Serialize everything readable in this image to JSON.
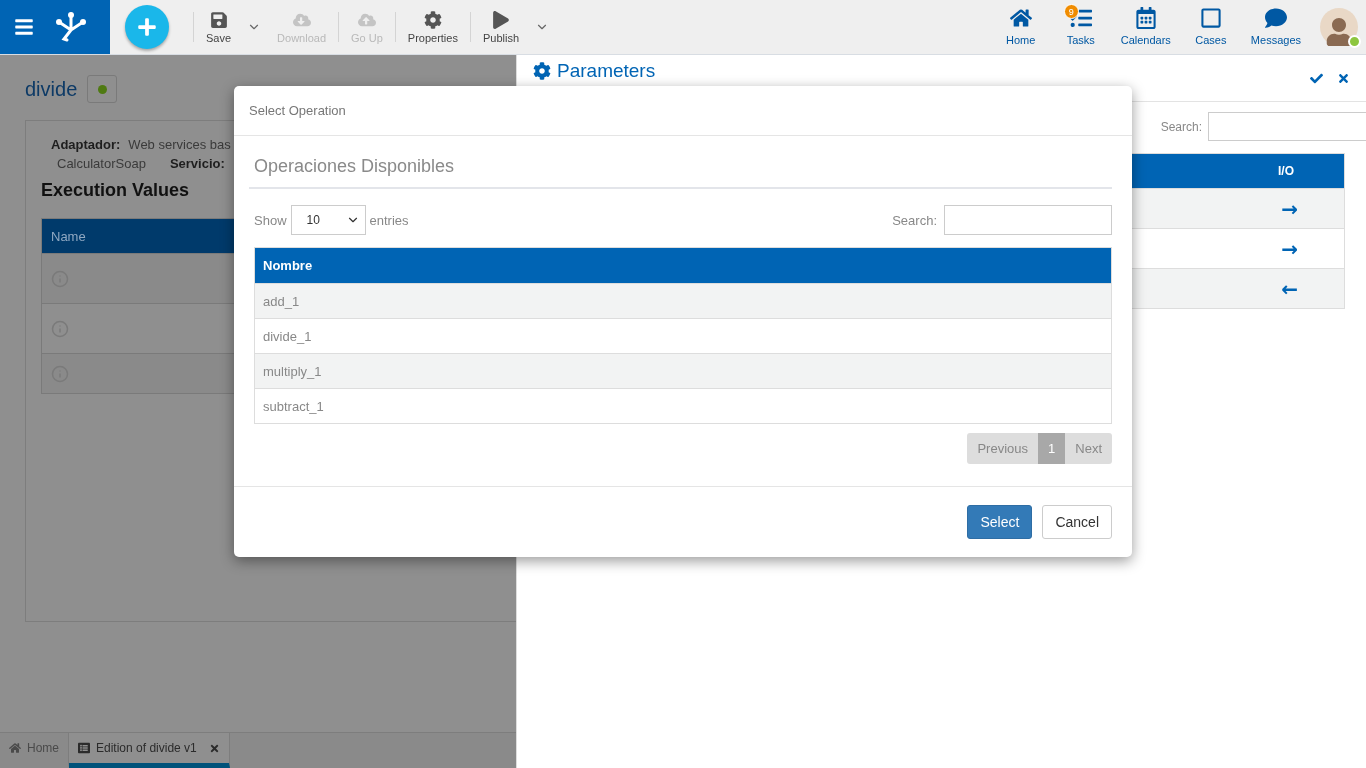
{
  "toolbar": {
    "groups": [
      [
        {
          "kind": "action",
          "label": "Save",
          "disabled": false
        },
        {
          "kind": "caret"
        },
        {
          "kind": "action",
          "label": "Download",
          "disabled": true
        }
      ],
      [
        {
          "kind": "action",
          "label": "Go Up",
          "disabled": true
        }
      ],
      [
        {
          "kind": "action",
          "label": "Properties",
          "disabled": false
        }
      ],
      [
        {
          "kind": "action",
          "label": "Publish",
          "disabled": false
        },
        {
          "kind": "caret"
        }
      ]
    ],
    "nav": [
      {
        "label": "Home"
      },
      {
        "label": "Tasks",
        "badge": "9"
      },
      {
        "label": "Calendars"
      },
      {
        "label": "Cases"
      },
      {
        "label": "Messages"
      }
    ]
  },
  "editor": {
    "title": "divide",
    "adapter_label": "Adaptador:",
    "adapter_value": "Web services bas",
    "port": "CalculatorSoap",
    "service_label": "Servicio:",
    "section_title": "Execution Values",
    "table": {
      "columns": [
        "Name"
      ],
      "rows": [
        {},
        {},
        {}
      ]
    }
  },
  "parameters": {
    "title": "Parameters",
    "search_label": "Search:",
    "table": {
      "columns": [
        "I/O"
      ],
      "rows": [
        {
          "io": "→"
        },
        {
          "io": "→"
        },
        {
          "io": "←"
        }
      ]
    }
  },
  "bottom_tabs": [
    {
      "label": "Home",
      "selected": false,
      "closable": false
    },
    {
      "label": "Edition of divide v1",
      "selected": true,
      "closable": true
    }
  ],
  "modal": {
    "title": "Select Operation",
    "heading": "Operaciones Disponibles",
    "show_label": "Show",
    "page_size": "10",
    "entries_label": "entries",
    "search_label": "Search:",
    "column": "Nombre",
    "rows": [
      {
        "name": "add_1"
      },
      {
        "name": "divide_1"
      },
      {
        "name": "multiply_1"
      },
      {
        "name": "subtract_1"
      }
    ],
    "pagination": {
      "previous": "Previous",
      "page": "1",
      "next": "Next"
    },
    "buttons": [
      {
        "label": "Select",
        "kind": "primary"
      },
      {
        "label": "Cancel",
        "kind": "default"
      }
    ]
  }
}
